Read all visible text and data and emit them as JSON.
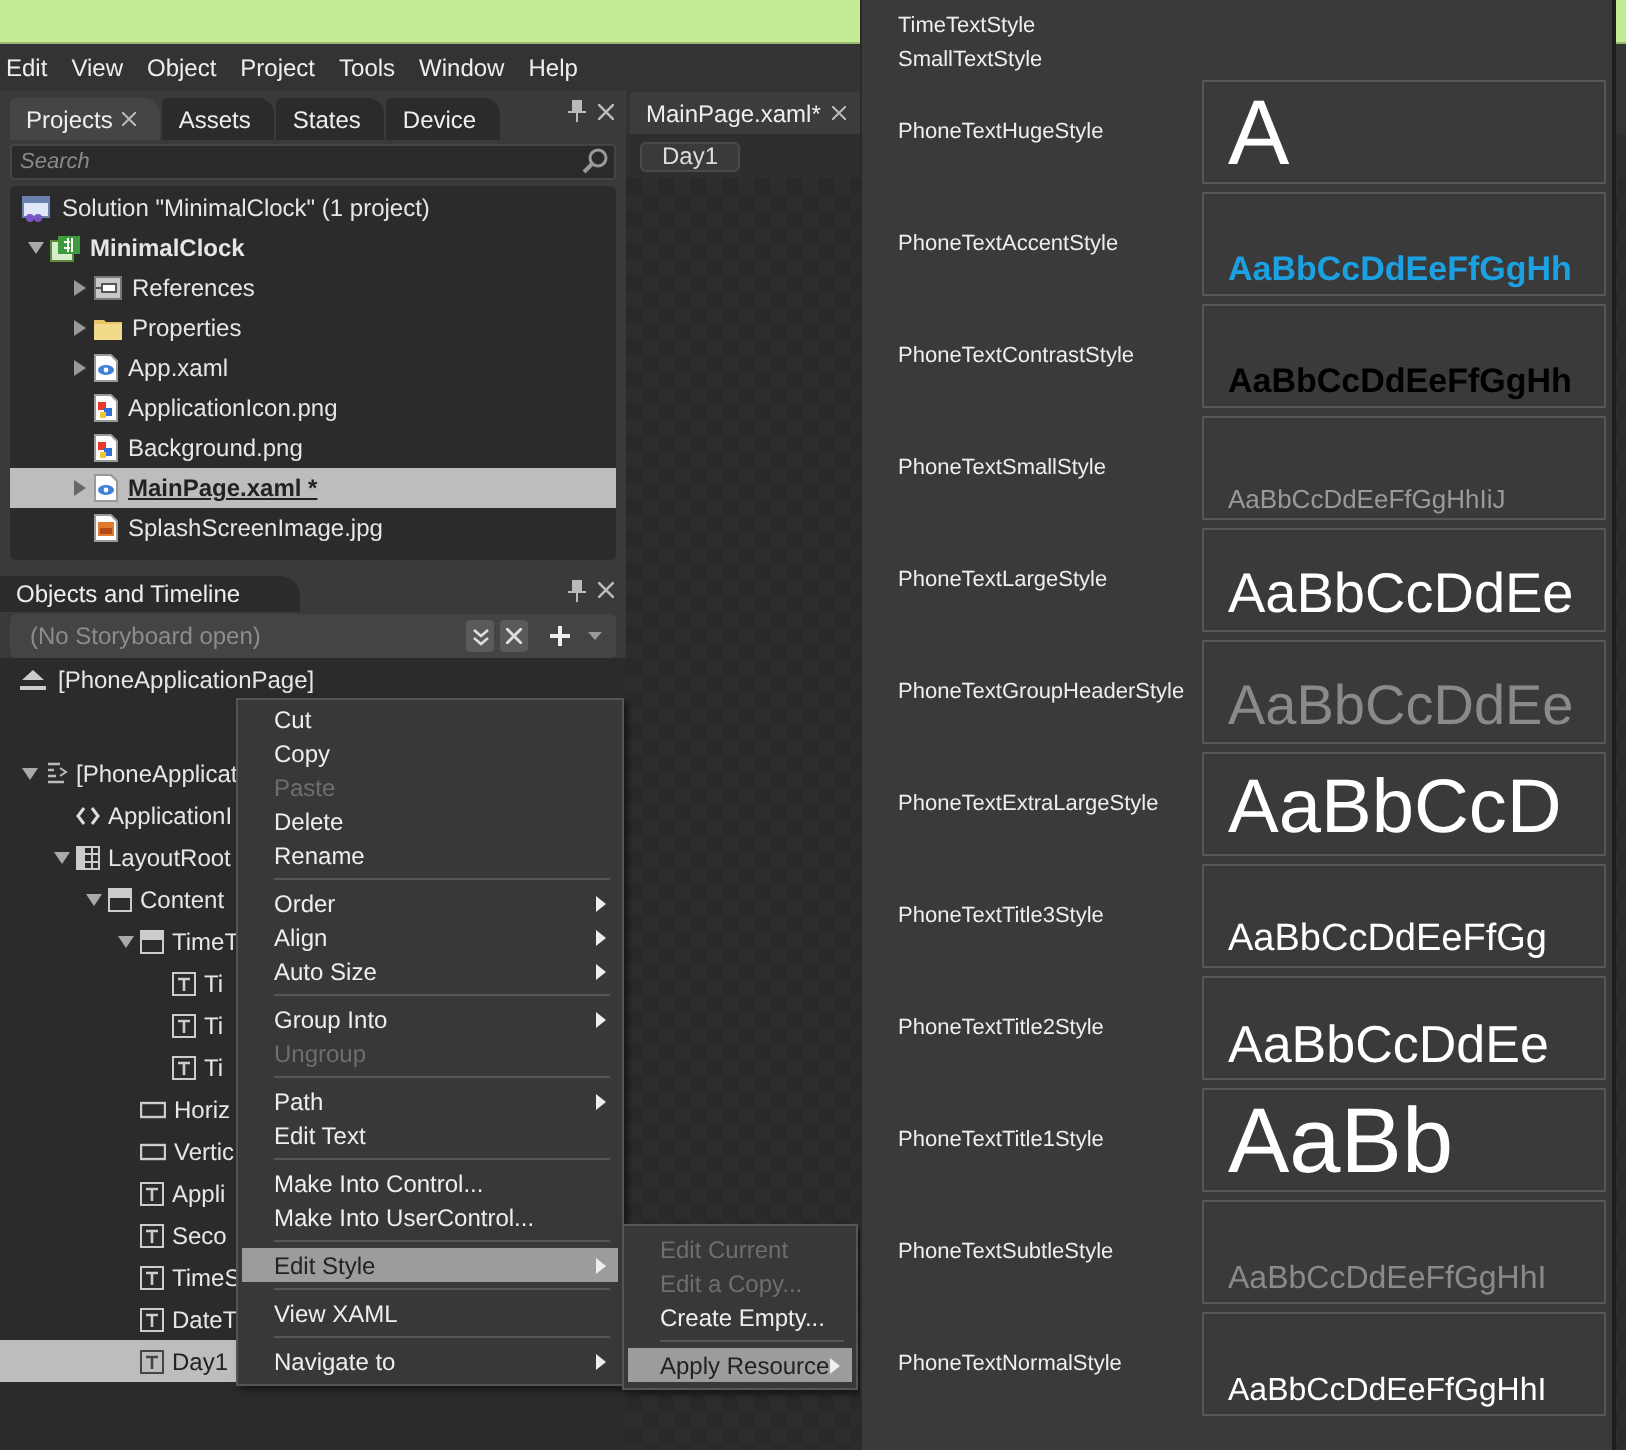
{
  "menu_bar": [
    "Edit",
    "View",
    "Object",
    "Project",
    "Tools",
    "Window",
    "Help"
  ],
  "projects_panel": {
    "tabs": [
      {
        "label": "Projects",
        "selected": true,
        "closable": true
      },
      {
        "label": "Assets",
        "selected": false,
        "closable": false
      },
      {
        "label": "States",
        "selected": false,
        "closable": false
      },
      {
        "label": "Device",
        "selected": false,
        "closable": false
      }
    ],
    "search": {
      "placeholder": "Search"
    },
    "tree": [
      {
        "label": "Solution \"MinimalClock\" (1 project)",
        "kind": "solution",
        "selected": false
      },
      {
        "label": "MinimalClock",
        "kind": "project",
        "selected": false,
        "expanded": true,
        "children": [
          {
            "label": "References",
            "kind": "references",
            "selected": false,
            "expanded": false
          },
          {
            "label": "Properties",
            "kind": "folder",
            "selected": false,
            "expanded": false
          },
          {
            "label": "App.xaml",
            "kind": "xaml",
            "selected": false,
            "expanded": false
          },
          {
            "label": "ApplicationIcon.png",
            "kind": "image",
            "selected": false
          },
          {
            "label": "Background.png",
            "kind": "image",
            "selected": false
          },
          {
            "label": "MainPage.xaml *",
            "kind": "xaml",
            "selected": true,
            "expanded": false
          },
          {
            "label": "SplashScreenImage.jpg",
            "kind": "photo",
            "selected": false
          }
        ]
      }
    ]
  },
  "objects_panel": {
    "title": "Objects and Timeline",
    "storyboard": "(No Storyboard open)",
    "scope": "[PhoneApplicationPage]",
    "tree": [
      {
        "label": "[PhoneApplicat",
        "kind": "page",
        "selected": false,
        "expanded": true,
        "children": [
          {
            "label": "ApplicationI",
            "kind": "resources",
            "selected": false
          },
          {
            "label": "LayoutRoot",
            "kind": "grid",
            "selected": false,
            "expanded": true,
            "children": [
              {
                "label": "Content",
                "kind": "panel",
                "selected": false,
                "expanded": true,
                "children": [
                  {
                    "label": "TimeT",
                    "kind": "panel",
                    "selected": false,
                    "expanded": true,
                    "children": [
                      {
                        "label": "Ti",
                        "kind": "text",
                        "selected": false
                      },
                      {
                        "label": "Ti",
                        "kind": "text",
                        "selected": false
                      },
                      {
                        "label": "Ti",
                        "kind": "text",
                        "selected": false
                      }
                    ]
                  },
                  {
                    "label": "Horiz",
                    "kind": "rectangle",
                    "selected": false
                  },
                  {
                    "label": "Vertic",
                    "kind": "rectangle",
                    "selected": false
                  },
                  {
                    "label": "Appli",
                    "kind": "text",
                    "selected": false
                  },
                  {
                    "label": "Seco",
                    "kind": "text",
                    "selected": false
                  },
                  {
                    "label": "TimeS",
                    "kind": "text",
                    "selected": false
                  },
                  {
                    "label": "DateT",
                    "kind": "text",
                    "selected": false
                  },
                  {
                    "label": "Day1",
                    "kind": "text",
                    "selected": true
                  }
                ]
              }
            ]
          }
        ]
      }
    ]
  },
  "document": {
    "tab": "MainPage.xaml*",
    "breadcrumb": "Day1"
  },
  "context_menu": {
    "groups": [
      [
        {
          "label": "Cut",
          "disabled": false,
          "submenu": false,
          "selected": false
        },
        {
          "label": "Copy",
          "disabled": false,
          "submenu": false,
          "selected": false
        },
        {
          "label": "Paste",
          "disabled": true,
          "submenu": false,
          "selected": false
        },
        {
          "label": "Delete",
          "disabled": false,
          "submenu": false,
          "selected": false
        },
        {
          "label": "Rename",
          "disabled": false,
          "submenu": false,
          "selected": false
        }
      ],
      [
        {
          "label": "Order",
          "disabled": false,
          "submenu": true,
          "selected": false
        },
        {
          "label": "Align",
          "disabled": false,
          "submenu": true,
          "selected": false
        },
        {
          "label": "Auto Size",
          "disabled": false,
          "submenu": true,
          "selected": false
        }
      ],
      [
        {
          "label": "Group Into",
          "disabled": false,
          "submenu": true,
          "selected": false
        },
        {
          "label": "Ungroup",
          "disabled": true,
          "submenu": false,
          "selected": false
        }
      ],
      [
        {
          "label": "Path",
          "disabled": false,
          "submenu": true,
          "selected": false
        },
        {
          "label": "Edit Text",
          "disabled": false,
          "submenu": false,
          "selected": false
        }
      ],
      [
        {
          "label": "Make Into Control...",
          "disabled": false,
          "submenu": false,
          "selected": false
        },
        {
          "label": "Make Into UserControl...",
          "disabled": false,
          "submenu": false,
          "selected": false
        }
      ],
      [
        {
          "label": "Edit Style",
          "disabled": false,
          "submenu": true,
          "selected": true
        }
      ],
      [
        {
          "label": "View XAML",
          "disabled": false,
          "submenu": false,
          "selected": false
        }
      ],
      [
        {
          "label": "Navigate to",
          "disabled": false,
          "submenu": true,
          "selected": false
        }
      ]
    ]
  },
  "submenu": {
    "groups": [
      [
        {
          "label": "Edit Current",
          "disabled": true,
          "submenu": false,
          "selected": false
        },
        {
          "label": "Edit a Copy...",
          "disabled": true,
          "submenu": false,
          "selected": false
        },
        {
          "label": "Create Empty...",
          "disabled": false,
          "submenu": false,
          "selected": false
        }
      ],
      [
        {
          "label": "Apply Resource",
          "disabled": false,
          "submenu": true,
          "selected": true
        }
      ]
    ]
  },
  "resource_popup": {
    "items": [
      {
        "name": "TimeTextStyle",
        "kind": "plain"
      },
      {
        "name": "SmallTextStyle",
        "kind": "plain"
      },
      {
        "name": "PhoneTextHugeStyle",
        "kind": "huge",
        "preview": "A"
      },
      {
        "name": "PhoneTextAccentStyle",
        "kind": "accent",
        "preview": "AaBbCcDdEeFfGgHh"
      },
      {
        "name": "PhoneTextContrastStyle",
        "kind": "contrast",
        "preview": "AaBbCcDdEeFfGgHh"
      },
      {
        "name": "PhoneTextSmallStyle",
        "kind": "small",
        "preview": "AaBbCcDdEeFfGgHhIiJ"
      },
      {
        "name": "PhoneTextLargeStyle",
        "kind": "large",
        "preview": "AaBbCcDdEe"
      },
      {
        "name": "PhoneTextGroupHeaderStyle",
        "kind": "group-header",
        "preview": "AaBbCcDdEe"
      },
      {
        "name": "PhoneTextExtraLargeStyle",
        "kind": "extra-large",
        "preview": "AaBbCcD"
      },
      {
        "name": "PhoneTextTitle3Style",
        "kind": "title3",
        "preview": "AaBbCcDdEeFfGg"
      },
      {
        "name": "PhoneTextTitle2Style",
        "kind": "title2",
        "preview": "AaBbCcDdEe"
      },
      {
        "name": "PhoneTextTitle1Style",
        "kind": "title1",
        "preview": "AaBb"
      },
      {
        "name": "PhoneTextSubtleStyle",
        "kind": "subtle",
        "preview": "AaBbCcDdEeFfGgHhI"
      },
      {
        "name": "PhoneTextNormalStyle",
        "kind": "normal",
        "preview": "AaBbCcDdEeFfGgHhI"
      }
    ]
  }
}
